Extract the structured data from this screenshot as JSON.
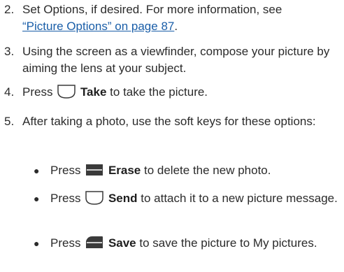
{
  "steps": [
    {
      "num": "2.",
      "text": "Set Options, if desired. For more information, see",
      "link": "“Picture Options” on page 87",
      "after_link": "."
    },
    {
      "num": "3.",
      "text": "Using the screen as a viewfinder, compose your picture by aiming the lens at your subject."
    },
    {
      "num": "4.",
      "pre": "Press",
      "key_label": "Take",
      "post": "to take the picture.",
      "key_icon": "left-soft-key-icon"
    },
    {
      "num": "5.",
      "text": "After taking a photo, use the soft keys for these options:"
    }
  ],
  "bullets": [
    {
      "pre": "Press",
      "key_label": "Erase",
      "post": "to delete the new photo.",
      "key_icon": "erase-soft-key-icon"
    },
    {
      "pre": "Press",
      "key_label": "Send",
      "post": "to attach it to a new picture message.",
      "key_icon": "left-soft-key-icon"
    },
    {
      "pre": "Press",
      "key_label": "Save",
      "post": "to save the picture to My pictures.",
      "key_icon": "save-soft-key-icon"
    }
  ],
  "colors": {
    "text": "#2b2b2b",
    "link": "#1a5ea8",
    "key_fill": "#3a3a3a"
  }
}
